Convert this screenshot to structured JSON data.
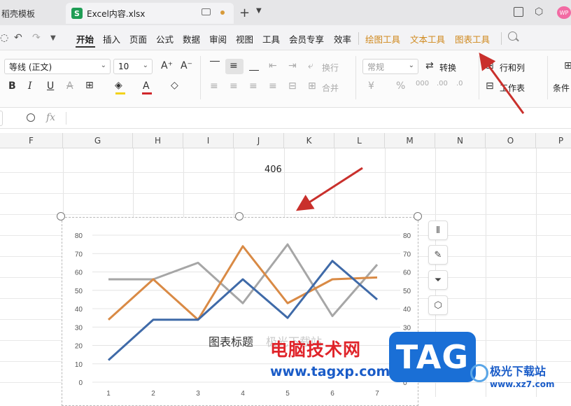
{
  "tabs": [
    {
      "label": "稻壳模板"
    },
    {
      "label": "Excel内容.xlsx",
      "badge": "S"
    }
  ],
  "tab_controls": {
    "add": "+",
    "more": "⌄"
  },
  "avatar": {
    "label": "WP"
  },
  "menu": {
    "items": [
      "开始",
      "插入",
      "页面",
      "公式",
      "数据",
      "审阅",
      "视图",
      "工具",
      "会员专享",
      "效率"
    ],
    "contextual": [
      "绘图工具",
      "文本工具",
      "图表工具"
    ],
    "active": "开始"
  },
  "ribbon": {
    "font_name": "等线 (正文)",
    "font_size": "10",
    "wrap_label": "换行",
    "merge_label": "合并",
    "number_format": "常规",
    "convert_label": "转换",
    "rows_cols_label": "行和列",
    "worksheet_label": "工作表",
    "conditional_label": "条件",
    "grow_font": "A⁺",
    "shrink_font": "A⁻",
    "bold": "B",
    "italic": "I",
    "underline": "U",
    "strike": "A"
  },
  "formula_bar": {
    "fx": "fx"
  },
  "columns": [
    "F",
    "G",
    "H",
    "I",
    "J",
    "K",
    "L",
    "M",
    "N",
    "O",
    "P"
  ],
  "cell_value": "406",
  "chart_data": {
    "type": "line",
    "title": "图表标题",
    "categories": [
      "1",
      "2",
      "3",
      "4",
      "5",
      "6",
      "7"
    ],
    "ylim": [
      0,
      80
    ],
    "yticks": [
      "0",
      "10",
      "20",
      "30",
      "40",
      "50",
      "60",
      "70",
      "80"
    ],
    "secondary_y": true,
    "grid": true,
    "series": [
      {
        "color": "#3f6aa8",
        "values": [
          12,
          34,
          34,
          56,
          35,
          66,
          45
        ]
      },
      {
        "color": "#d98a45",
        "values": [
          34,
          56,
          34,
          74,
          43,
          56,
          57
        ]
      },
      {
        "color": "#a6a6a6",
        "values": [
          56,
          56,
          65,
          43,
          75,
          36,
          64
        ]
      }
    ]
  },
  "side_tools": [
    "chart-elements-icon",
    "chart-style-icon",
    "chart-filter-icon",
    "chart-settings-icon"
  ],
  "watermark": {
    "overlay_text": "极光下载站",
    "brand_cn": "电脑技术网",
    "url": "www.tagxp.com",
    "tag": "TAG",
    "site_name": "极光下载站",
    "site_url": "www.xz7.com"
  },
  "colors": {
    "accent": "#d08a1f",
    "arrow": "#c9302c"
  }
}
